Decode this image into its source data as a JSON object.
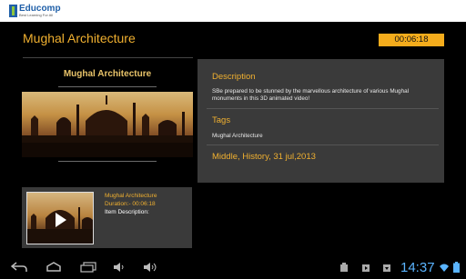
{
  "app": {
    "logo_name": "Educomp",
    "logo_tagline": "Best Learning For All"
  },
  "header": {
    "title": "Mughal Architecture",
    "timer": "00:06:18"
  },
  "preview": {
    "title": "Mughal Architecture"
  },
  "details": {
    "description_heading": "Description",
    "description_text": "SBe prepared to be stunned by the marvellous architecture  of various Mughal monuments in this 3D animated video!",
    "tags_heading": "Tags",
    "tags_text": "Mughal Architecture",
    "meta": "Middle, History, 31 jul,2013"
  },
  "list": {
    "items": [
      {
        "title": "Mughal Architecture",
        "duration": "Duration:-  00:06:18",
        "description": "Item Description:"
      }
    ]
  },
  "system_bar": {
    "clock": "14:37",
    "icons": [
      "back-icon",
      "home-icon",
      "recent-apps-icon",
      "volume-down-icon",
      "volume-up-icon",
      "notification-icon",
      "media-icon",
      "download-icon",
      "wifi-icon",
      "battery-icon"
    ]
  }
}
